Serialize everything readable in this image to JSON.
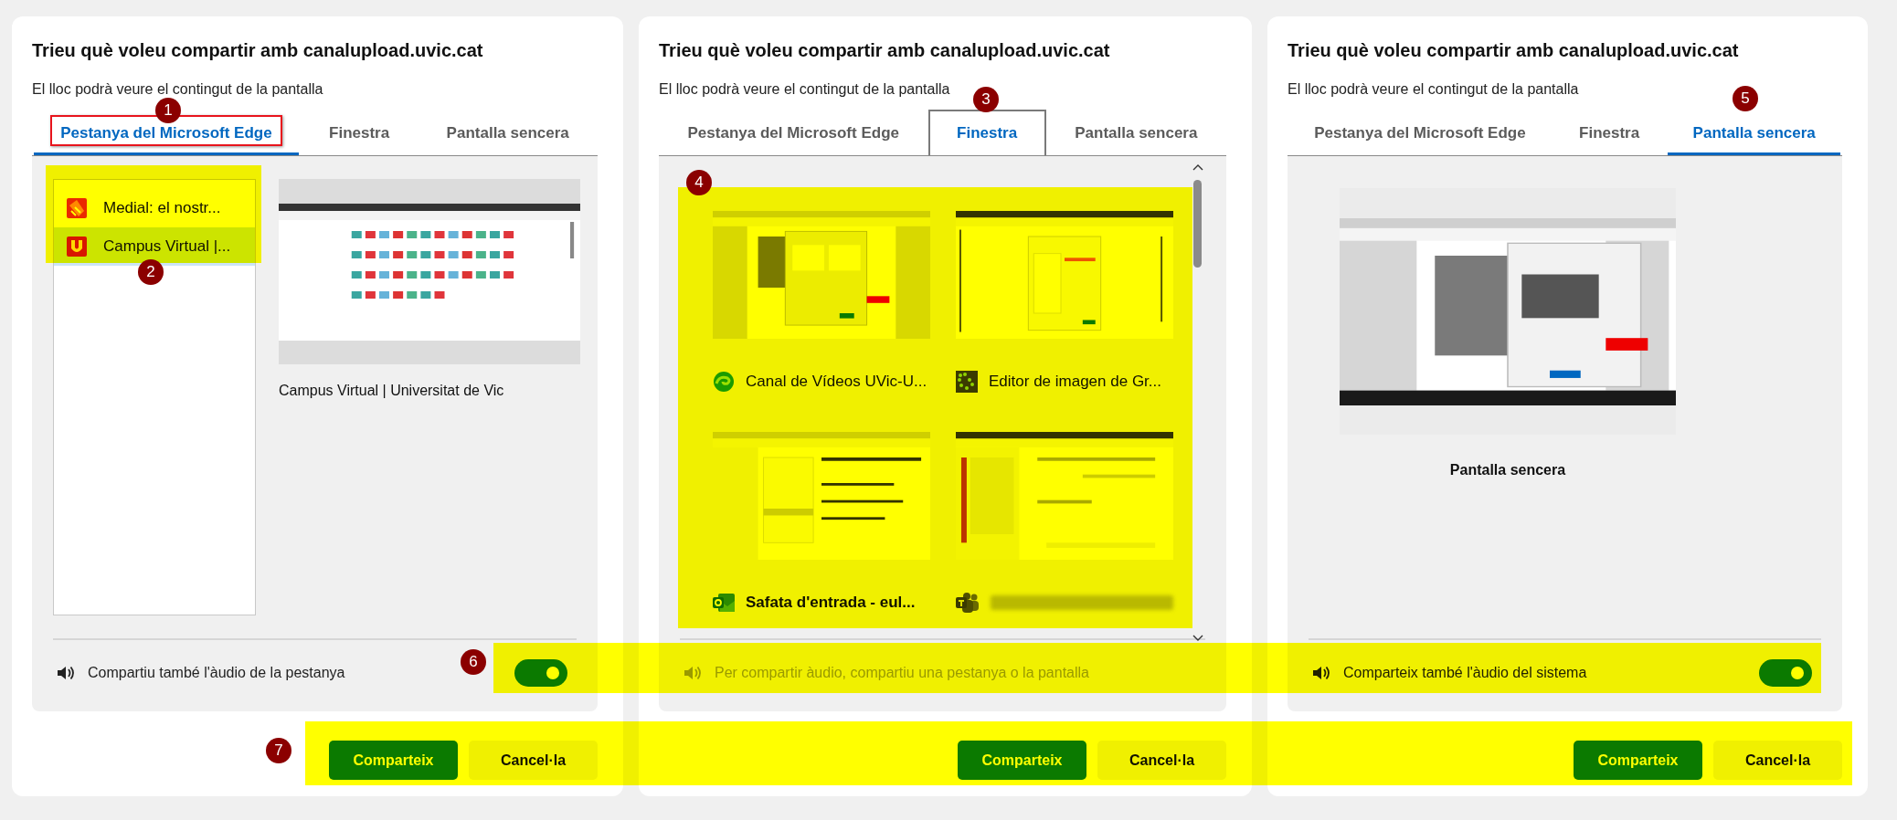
{
  "dialogs": [
    {
      "kind": "tab",
      "title": "Trieu què voleu compartir amb canalupload.uvic.cat",
      "subtitle": "El lloc podrà veure el contingut de la pantalla",
      "tabs": [
        {
          "label": "Pestanya del Microsoft Edge",
          "selected": true,
          "focused": false
        },
        {
          "label": "Finestra",
          "selected": false,
          "focused": false
        },
        {
          "label": "Pantalla sencera",
          "selected": false,
          "focused": false
        }
      ],
      "tab_items": [
        {
          "label": "Medial: el nostr...",
          "selected": false
        },
        {
          "label": "Campus Virtual |...",
          "selected": true
        }
      ],
      "preview_caption": "Campus Virtual | Universitat de Vic",
      "audio": {
        "label": "Compartiu també l'àudio de la pestanya",
        "disabled": false,
        "on": true
      },
      "buttons": [
        {
          "label": "Comparteix",
          "kind": "primary"
        },
        {
          "label": "Cancel·la",
          "kind": "secondary"
        }
      ]
    },
    {
      "kind": "window",
      "title": "Trieu què voleu compartir amb canalupload.uvic.cat",
      "subtitle": "El lloc podrà veure el contingut de la pantalla",
      "tabs": [
        {
          "label": "Pestanya del Microsoft Edge",
          "selected": false,
          "focused": false
        },
        {
          "label": "Finestra",
          "selected": true,
          "focused": true
        },
        {
          "label": "Pantalla sencera",
          "selected": false,
          "focused": false
        }
      ],
      "windows": [
        {
          "label": "Canal de Vídeos UVic-U...",
          "selected": false,
          "redacted": false
        },
        {
          "label": "Editor de imagen de Gr...",
          "selected": false,
          "redacted": false
        },
        {
          "label": "Safata d'entrada - eul...",
          "selected": true,
          "redacted": false
        },
        {
          "selected": false,
          "redacted": true
        }
      ],
      "audio": {
        "label": "Per compartir àudio, compartiu una pestanya o la pantalla",
        "disabled": true
      },
      "buttons": [
        {
          "label": "Comparteix",
          "kind": "primary"
        },
        {
          "label": "Cancel·la",
          "kind": "secondary"
        }
      ]
    },
    {
      "kind": "screen",
      "title": "Trieu què voleu compartir amb canalupload.uvic.cat",
      "subtitle": "El lloc podrà veure el contingut de la pantalla",
      "tabs": [
        {
          "label": "Pestanya del Microsoft Edge",
          "selected": false,
          "focused": false
        },
        {
          "label": "Finestra",
          "selected": false,
          "focused": false
        },
        {
          "label": "Pantalla sencera",
          "selected": true,
          "focused": false
        }
      ],
      "screen_caption": "Pantalla sencera",
      "audio": {
        "label": "Comparteix també l'àudio del sistema",
        "disabled": false,
        "on": true
      },
      "buttons": [
        {
          "label": "Comparteix",
          "kind": "primary"
        },
        {
          "label": "Cancel·la",
          "kind": "secondary"
        }
      ]
    }
  ],
  "annotations": [
    "1",
    "2",
    "3",
    "4",
    "5",
    "6",
    "7"
  ]
}
